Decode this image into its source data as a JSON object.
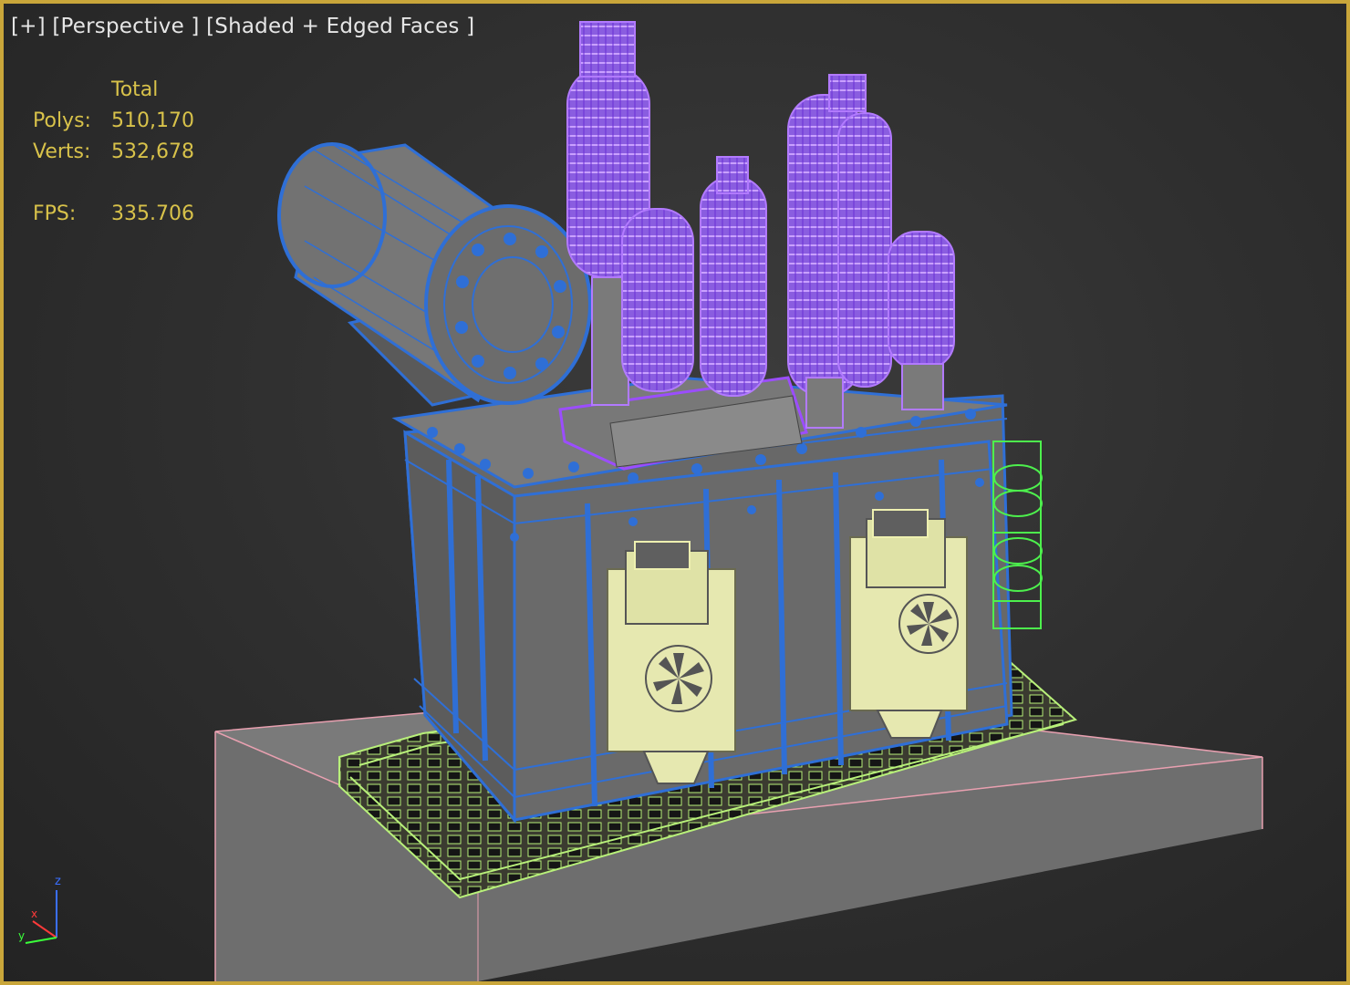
{
  "viewport": {
    "labels": {
      "menu": "[+]",
      "view": "[Perspective ]",
      "shading": "[Shaded + Edged Faces ]"
    },
    "stats": {
      "header": "Total",
      "polys_label": "Polys:",
      "polys_value": "510,170",
      "verts_label": "Verts:",
      "verts_value": "532,678",
      "fps_label": "FPS:",
      "fps_value": "335.706"
    },
    "gizmo": {
      "z": "z",
      "x": "x",
      "y": "y"
    }
  },
  "colors": {
    "border": "#c9a63a",
    "stat_text": "#d8c24a",
    "label_text": "#e6e6e6",
    "tank_wire": "#2f6fd6",
    "bushing_wire": "#9b4dff",
    "radiator_wire": "#eef0b0",
    "rail_wire": "#b8f07a",
    "green_wire": "#4df04d",
    "base_wire": "#e8a0b0",
    "shaded_gray": "#707070"
  }
}
